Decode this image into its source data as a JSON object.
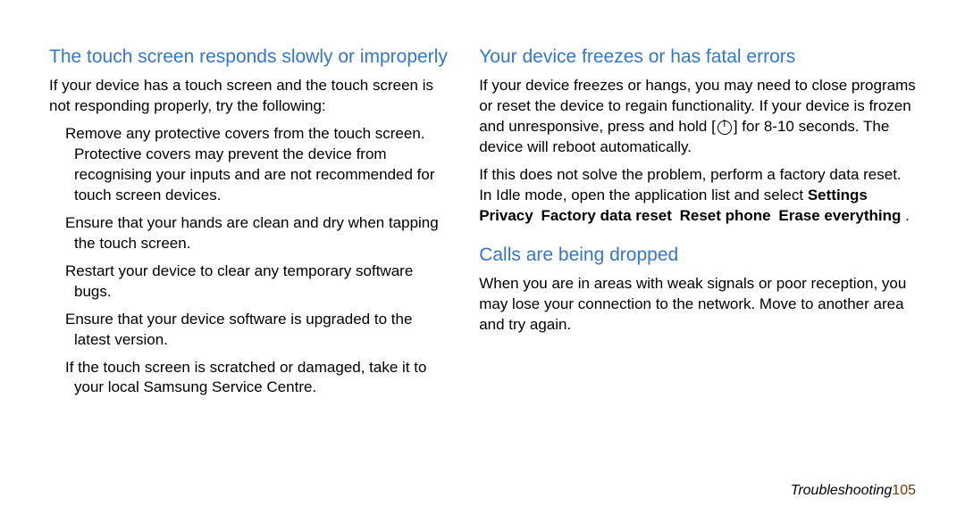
{
  "bullet_char": "",
  "left": {
    "heading": "The touch screen responds slowly or improperly",
    "intro": "If your device has a touch screen and the touch screen is not responding properly, try the following:",
    "items": [
      "Remove any protective covers from the touch screen. Protective covers may prevent the device from recognising your inputs and are not recommended for touch screen devices.",
      "Ensure that your hands are clean and dry when tapping the touch screen.",
      "Restart your device to clear any temporary software bugs.",
      "Ensure that your device software is upgraded to the latest version.",
      "If the touch screen is scratched or damaged, take it to your local Samsung Service Centre."
    ]
  },
  "right": {
    "section1": {
      "heading": "Your device freezes or has fatal errors",
      "para1a": "If your device freezes or hangs, you may need to close programs or reset the device to regain functionality. If your device is frozen and unresponsive, press and hold [",
      "para1b": "] for 8-10 seconds. The device will reboot automatically.",
      "para2_prefix": "If this does not solve the problem, perform a factory data reset. In Idle mode, open the application list and select ",
      "menu_path": {
        "arrow": "",
        "steps": [
          "Settings",
          "Privacy",
          "Factory data reset",
          "Reset phone",
          "Erase everything"
        ]
      },
      "para2_suffix": "."
    },
    "section2": {
      "heading": "Calls are being dropped",
      "para": "When you are in areas with weak signals or poor reception, you may lose your connection to the network. Move to another area and try again."
    }
  },
  "footer": {
    "section": "Troubleshooting",
    "page": "105"
  }
}
